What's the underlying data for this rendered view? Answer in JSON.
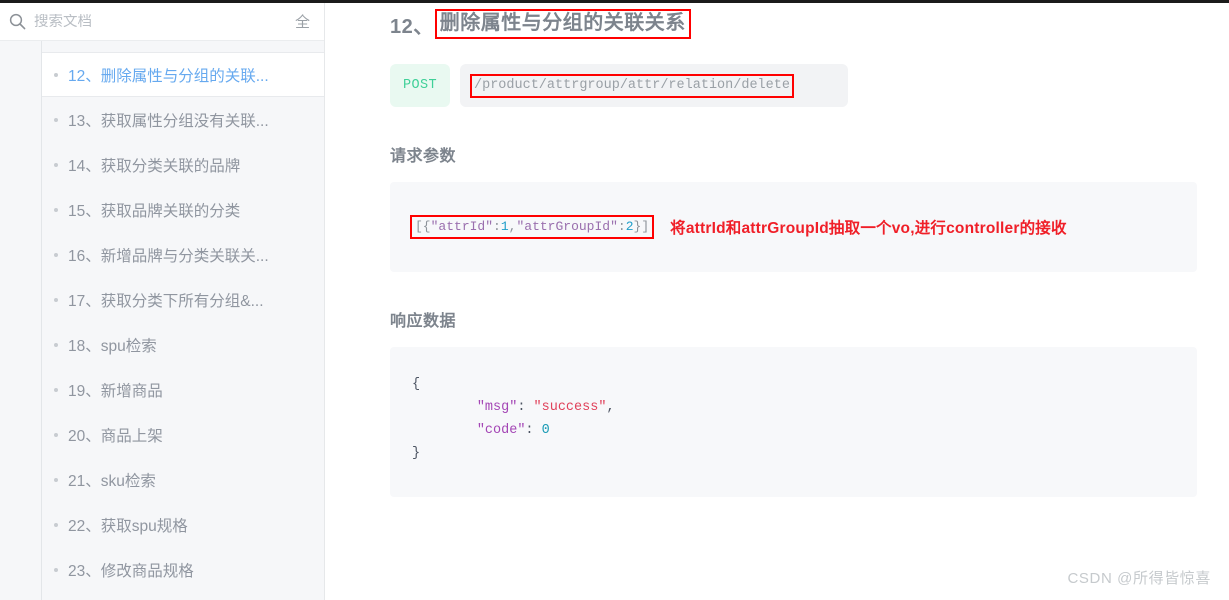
{
  "sidebar": {
    "search": {
      "placeholder": "搜索文档",
      "value": "",
      "scope_label": "全",
      "icon": "search-icon"
    },
    "items": [
      {
        "label": "12、删除属性与分组的关联...",
        "active": true
      },
      {
        "label": "13、获取属性分组没有关联...",
        "active": false
      },
      {
        "label": "14、获取分类关联的品牌",
        "active": false
      },
      {
        "label": "15、获取品牌关联的分类",
        "active": false
      },
      {
        "label": "16、新增品牌与分类关联关...",
        "active": false
      },
      {
        "label": "17、获取分类下所有分组&...",
        "active": false
      },
      {
        "label": "18、spu检索",
        "active": false
      },
      {
        "label": "19、新增商品",
        "active": false
      },
      {
        "label": "20、商品上架",
        "active": false
      },
      {
        "label": "21、sku检索",
        "active": false
      },
      {
        "label": "22、获取spu规格",
        "active": false
      },
      {
        "label": "23、修改商品规格",
        "active": false
      }
    ]
  },
  "main": {
    "title_number": "12、",
    "title_text": "删除属性与分组的关联关系",
    "method": "POST",
    "url": "/product/attrgroup/attr/relation/delete",
    "request_section_title": "请求参数",
    "request_body_prefix": "[{",
    "request_body_key1": "\"attrId\"",
    "request_body_sep1": ":",
    "request_body_val1": "1",
    "request_body_comma": ",",
    "request_body_key2": "\"attrGroupId\"",
    "request_body_sep2": ":",
    "request_body_val2": "2",
    "request_body_suffix": "}]",
    "annotation": "将attrId和attrGroupId抽取一个vo,进行controller的接收",
    "response_section_title": "响应数据",
    "response_json": {
      "open_brace": "{",
      "line1_key": "\"msg\"",
      "line1_colon": ": ",
      "line1_val": "\"success\"",
      "line1_comma": ",",
      "line2_key": "\"code\"",
      "line2_colon": ": ",
      "line2_val": "0",
      "close_brace": "}"
    }
  },
  "watermark": "CSDN @所得皆惊喜",
  "colors": {
    "method_badge_bg": "#e9f9f1",
    "method_badge_text": "#3fd098",
    "highlight_box": "#ff0000",
    "annotation_text": "#f01f28",
    "active_item_text": "#66a9ef",
    "sidebar_bg": "#f6f7f9",
    "code_panel_bg": "#f7f8fa"
  }
}
